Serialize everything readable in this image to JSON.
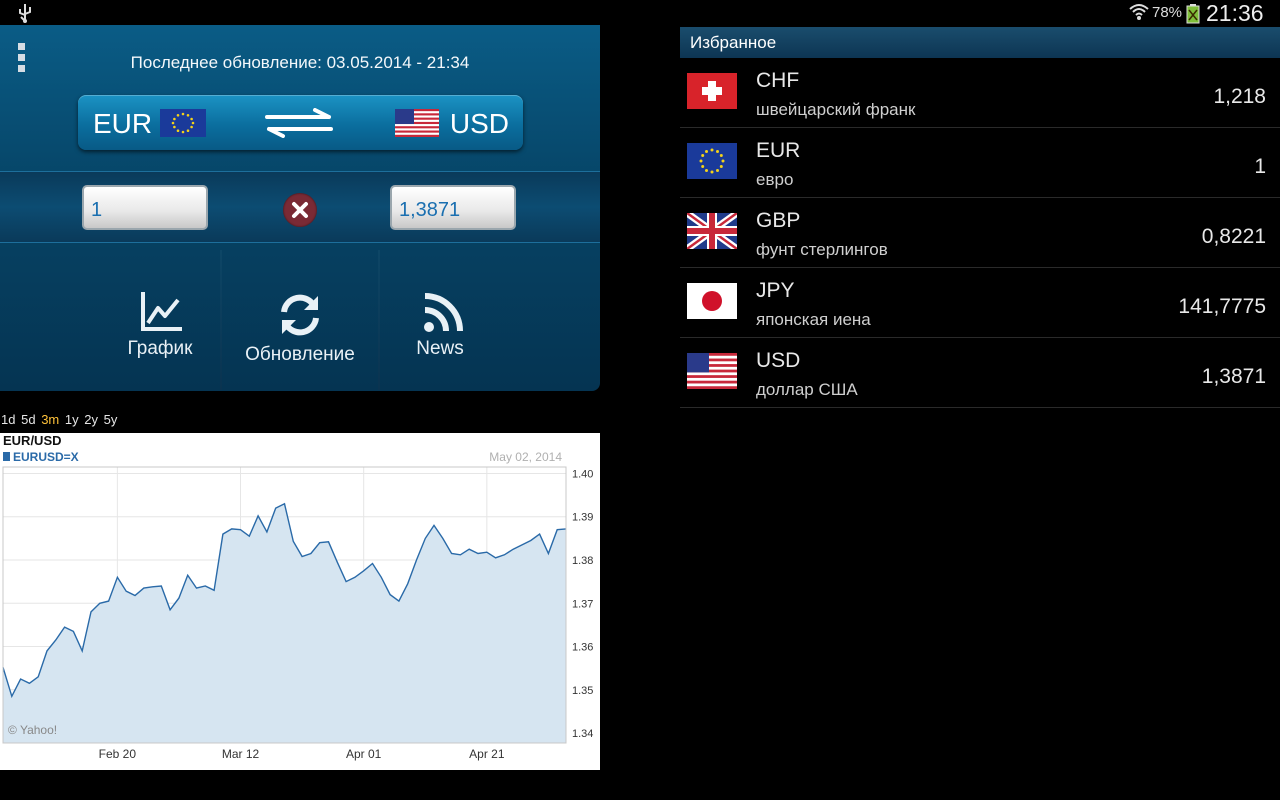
{
  "status_bar": {
    "battery_percent": "78%",
    "clock": "21:36",
    "icons": [
      "usb-icon",
      "wifi-icon",
      "battery-icon"
    ]
  },
  "converter": {
    "last_update": "Последнее обновление: 03.05.2014 - 21:34",
    "from_currency": "EUR",
    "to_currency": "USD",
    "from_amount": "1",
    "to_amount": "1,3871",
    "actions": {
      "chart": "График",
      "refresh": "Обновление",
      "news": "News"
    }
  },
  "periods": {
    "items": [
      "1d",
      "5d",
      "3m",
      "1y",
      "2y",
      "5y"
    ],
    "active": "3m"
  },
  "chart_data": {
    "type": "area",
    "title": "EUR/USD",
    "series": [
      {
        "name": "EURUSD=X",
        "color": "#2a6aa8"
      }
    ],
    "date_label": "May 02, 2014",
    "watermark": "© Yahoo!",
    "x_ticks": [
      "Feb 20",
      "Mar 12",
      "Apr 01",
      "Apr 21"
    ],
    "y_ticks": [
      "1.40",
      "1.39",
      "1.38",
      "1.37",
      "1.36",
      "1.35",
      "1.34"
    ],
    "ylim": [
      1.34,
      1.4
    ],
    "x": [
      "Feb 03",
      "Feb 04",
      "Feb 05",
      "Feb 06",
      "Feb 07",
      "Feb 10",
      "Feb 11",
      "Feb 12",
      "Feb 13",
      "Feb 14",
      "Feb 17",
      "Feb 18",
      "Feb 19",
      "Feb 20",
      "Feb 21",
      "Feb 24",
      "Feb 25",
      "Feb 26",
      "Feb 27",
      "Feb 28",
      "Mar 03",
      "Mar 04",
      "Mar 05",
      "Mar 06",
      "Mar 07",
      "Mar 10",
      "Mar 11",
      "Mar 12",
      "Mar 13",
      "Mar 14",
      "Mar 17",
      "Mar 18",
      "Mar 19",
      "Mar 20",
      "Mar 21",
      "Mar 24",
      "Mar 25",
      "Mar 26",
      "Mar 27",
      "Mar 28",
      "Mar 31",
      "Apr 01",
      "Apr 02",
      "Apr 03",
      "Apr 04",
      "Apr 07",
      "Apr 08",
      "Apr 09",
      "Apr 10",
      "Apr 11",
      "Apr 14",
      "Apr 15",
      "Apr 16",
      "Apr 17",
      "Apr 18",
      "Apr 21",
      "Apr 22",
      "Apr 23",
      "Apr 24",
      "Apr 25",
      "Apr 28",
      "Apr 29",
      "Apr 30",
      "May 01",
      "May 02"
    ],
    "values": [
      1.3552,
      1.3485,
      1.3525,
      1.3515,
      1.353,
      1.359,
      1.3615,
      1.3645,
      1.3635,
      1.359,
      1.368,
      1.37,
      1.3705,
      1.376,
      1.3728,
      1.3718,
      1.3735,
      1.3738,
      1.374,
      1.3685,
      1.3712,
      1.3765,
      1.3735,
      1.374,
      1.373,
      1.386,
      1.3872,
      1.387,
      1.3855,
      1.3902,
      1.3865,
      1.392,
      1.393,
      1.3843,
      1.3808,
      1.3815,
      1.384,
      1.3842,
      1.3795,
      1.375,
      1.376,
      1.3775,
      1.3792,
      1.376,
      1.372,
      1.3705,
      1.3745,
      1.38,
      1.385,
      1.388,
      1.385,
      1.3815,
      1.3812,
      1.3825,
      1.3815,
      1.3818,
      1.3805,
      1.3812,
      1.3825,
      1.3835,
      1.3845,
      1.386,
      1.3815,
      1.387,
      1.3872
    ]
  },
  "favorites": {
    "title": "Избранное",
    "rows": [
      {
        "code": "CHF",
        "name": "швейцарский франк",
        "value": "1,218",
        "flag": "ch-flag"
      },
      {
        "code": "EUR",
        "name": "евро",
        "value": "1",
        "flag": "eu-flag"
      },
      {
        "code": "GBP",
        "name": "фунт стерлингов",
        "value": "0,8221",
        "flag": "gb-flag"
      },
      {
        "code": "JPY",
        "name": "японская иена",
        "value": "141,7775",
        "flag": "jp-flag"
      },
      {
        "code": "USD",
        "name": "доллар США",
        "value": "1,3871",
        "flag": "us-flag"
      }
    ]
  }
}
